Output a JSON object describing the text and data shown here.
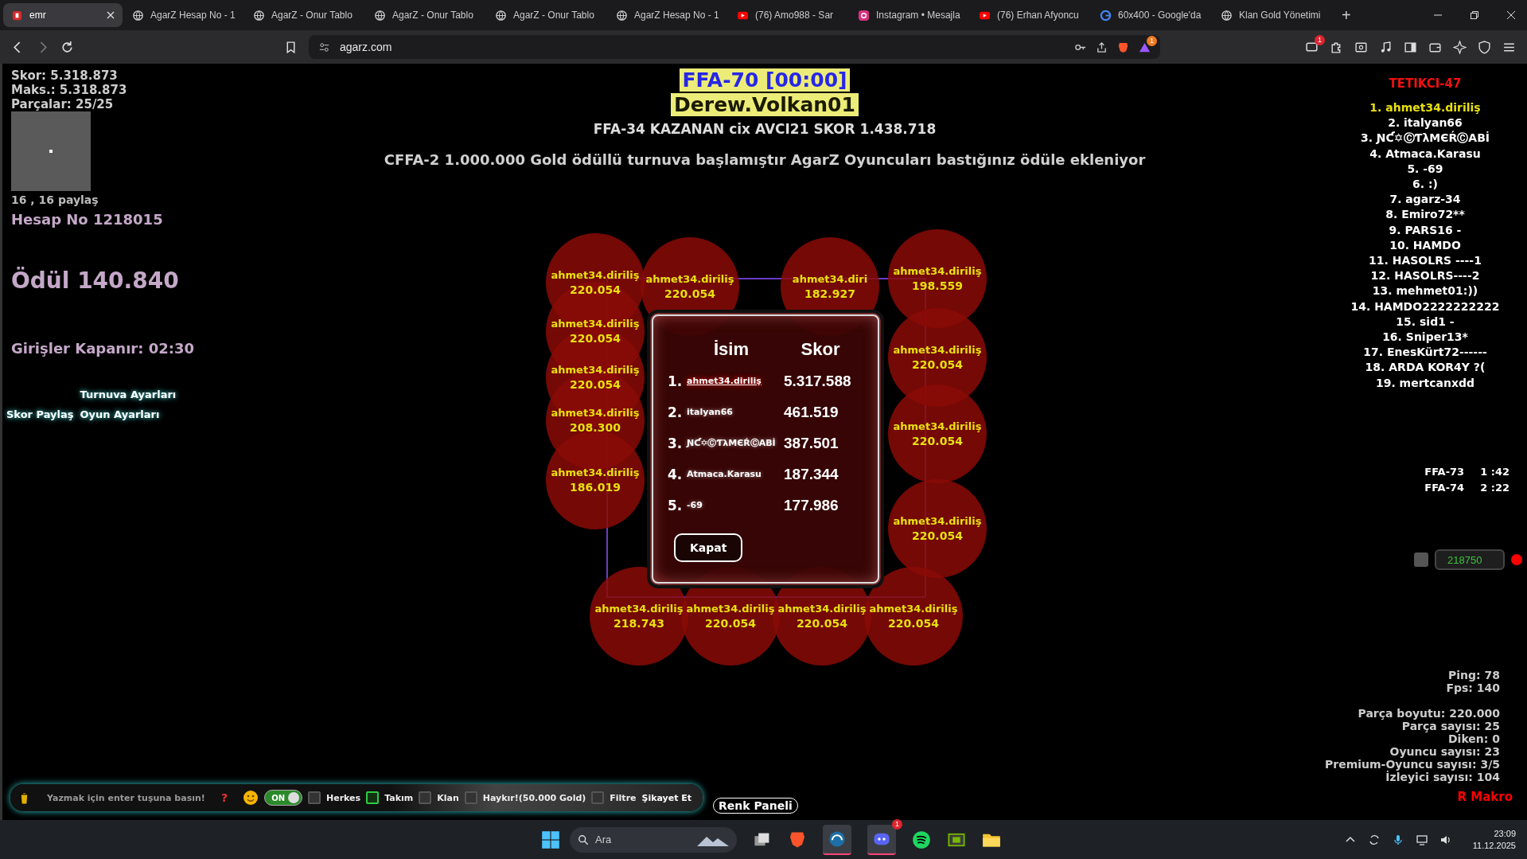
{
  "browser": {
    "tabs": [
      {
        "title": "emr",
        "kind": "site",
        "selected": true
      },
      {
        "title": "AgarZ Hesap No - 1",
        "kind": "globe",
        "selected": false
      },
      {
        "title": "AgarZ - Onur Tablo",
        "kind": "globe",
        "selected": false
      },
      {
        "title": "AgarZ - Onur Tablo",
        "kind": "globe",
        "selected": false
      },
      {
        "title": "AgarZ - Onur Tablo",
        "kind": "globe",
        "selected": false
      },
      {
        "title": "AgarZ Hesap No - 1",
        "kind": "globe",
        "selected": false
      },
      {
        "title": "(76) Amo988 - Sar",
        "kind": "video",
        "selected": false
      },
      {
        "title": "Instagram • Mesajla",
        "kind": "instagram",
        "selected": false
      },
      {
        "title": "(76) Erhan Afyoncu",
        "kind": "video",
        "selected": false
      },
      {
        "title": "60x400 - Google'da",
        "kind": "google",
        "selected": false
      },
      {
        "title": "Klan Gold Yönetimi",
        "kind": "globe",
        "selected": false
      }
    ],
    "new_tab": "+",
    "address": "agarz.com",
    "alert_badge": "1",
    "extension_badge": "1"
  },
  "hud_left": {
    "score": "Skor: 5.318.873",
    "max": "Maks.: 5.318.873",
    "pieces": "Parçalar: 25/25",
    "coords": "16 , 16 paylaş",
    "account": "Hesap No 1218015",
    "prize": "Ödül 140.840",
    "entries": "Girişler Kapanır: 02:30",
    "buttons": [
      "Turnuva Ayarları",
      "Skor Paylaş",
      "Oyun Ayarları"
    ]
  },
  "top": {
    "mode": "FFA-70 [00:00]",
    "player": "Derew.Volkan01",
    "winner": "FFA-34 KAZANAN cix AVCI21 SKOR 1.438.718",
    "announcement": "CFFA-2 1.000.000 Gold ödüllü turnuva başlamıştır AgarZ Oyuncuları bastığınız ödüle ekleniyor"
  },
  "cells": [
    {
      "name": "ahmet34.diriliş",
      "score": "220.054"
    },
    {
      "name": "ahmet34.diriliş",
      "score": "220.054"
    },
    {
      "name": "ahmet34.diriliş",
      "score": "220.054"
    },
    {
      "name": "ahmet34.diriliş",
      "score": "208.300"
    },
    {
      "name": "ahmet34.diriliş",
      "score": "186.019"
    },
    {
      "name": "ahmet34.diriliş",
      "score": "220.054"
    },
    {
      "name": "ahmet34.diri",
      "score": "182.927"
    },
    {
      "name": "ahmet34.diriliş",
      "score": "198.559"
    },
    {
      "name": "ahmet34.diriliş",
      "score": "220.054"
    },
    {
      "name": "ahmet34.diriliş",
      "score": "220.054"
    },
    {
      "name": "ahmet34.diriliş",
      "score": "220.054"
    },
    {
      "name": "ahmet34.diriliş",
      "score": "218.743"
    },
    {
      "name": "ahmet34.diriliş",
      "score": "220.054"
    },
    {
      "name": "ahmet34.diriliş",
      "score": "220.054"
    },
    {
      "name": "ahmet34.diriliş",
      "score": "220.054"
    }
  ],
  "popup": {
    "headers": [
      "İsim",
      "Skor"
    ],
    "rows": [
      {
        "rank": "1.",
        "name": "ahmet34.diriliş",
        "score": "5.317.588",
        "selected": true
      },
      {
        "rank": "2.",
        "name": "italyan66",
        "score": "461.519",
        "selected": false
      },
      {
        "rank": "3.",
        "name": "ƝƇ✡ⒸƬλMЄŔⒸABİ",
        "score": "387.501",
        "selected": false
      },
      {
        "rank": "4.",
        "name": "Atmaca.Karasu",
        "score": "187.344",
        "selected": false
      },
      {
        "rank": "5.",
        "name": "-69",
        "score": "177.986",
        "selected": false
      }
    ],
    "close": "Kapat"
  },
  "leaderboard": {
    "title": "TETIKCI-47",
    "entries": [
      {
        "text": "1. ahmet34.diriliş",
        "selected": true
      },
      {
        "text": "2. italyan66",
        "selected": false
      },
      {
        "text": "3. ƝƇ✡ⒸƬλMЄŔⒸABİ",
        "selected": false
      },
      {
        "text": "4. Atmaca.Karasu",
        "selected": false
      },
      {
        "text": "5. -69",
        "selected": false
      },
      {
        "text": "6. :)",
        "selected": false
      },
      {
        "text": "7. agarz-34",
        "selected": false
      },
      {
        "text": "8. Emiro72**",
        "selected": false
      },
      {
        "text": "9. PARS16 -",
        "selected": false
      },
      {
        "text": "10. HAMDO",
        "selected": false
      },
      {
        "text": "11. HASOLRS ----1",
        "selected": false
      },
      {
        "text": "12. HASOLRS----2",
        "selected": false
      },
      {
        "text": "13. mehmet01:))",
        "selected": false
      },
      {
        "text": "14. HAMDO2222222222",
        "selected": false
      },
      {
        "text": "15. sid1 -",
        "selected": false
      },
      {
        "text": "16. Sniper13*",
        "selected": false
      },
      {
        "text": "17. EnesKürt72------",
        "selected": false
      },
      {
        "text": "18. ARDA KOR4Y ?(",
        "selected": false
      },
      {
        "text": "19. mertcanxdd",
        "selected": false
      }
    ],
    "timers": [
      {
        "name": "FFA-73",
        "time": "1 :42"
      },
      {
        "name": "FFA-74",
        "time": "2 :22"
      }
    ]
  },
  "split": {
    "value": "218750",
    "recording": true
  },
  "stats": {
    "network": [
      "Ping: 78",
      "Fps: 140"
    ],
    "server": [
      "Parça boyutu: 220.000",
      "Parça sayısı: 25",
      "Diken: 0",
      "Oyuncu sayısı: 23",
      "Premium-Oyuncu sayısı: 3/5",
      "İzleyici sayısı: 104"
    ]
  },
  "macro": "R Makro",
  "chat": {
    "placeholder": "Yazmak için enter tuşuna basın!",
    "help": "?",
    "toggle": {
      "label": "ON",
      "on": true
    },
    "filters": [
      {
        "label": "Herkes",
        "checked": false
      },
      {
        "label": "Takım",
        "checked": true
      },
      {
        "label": "Klan",
        "checked": false
      },
      {
        "label": "Haykır!(50.000 Gold)",
        "checked": false
      },
      {
        "label": "Filtre",
        "checked": false
      }
    ],
    "report": "Şikayet Et"
  },
  "color_panel": "Renk Paneli",
  "taskbar": {
    "search": "Ara",
    "time": "23:09",
    "date": "11.12.2025",
    "chat_badge": "1"
  }
}
